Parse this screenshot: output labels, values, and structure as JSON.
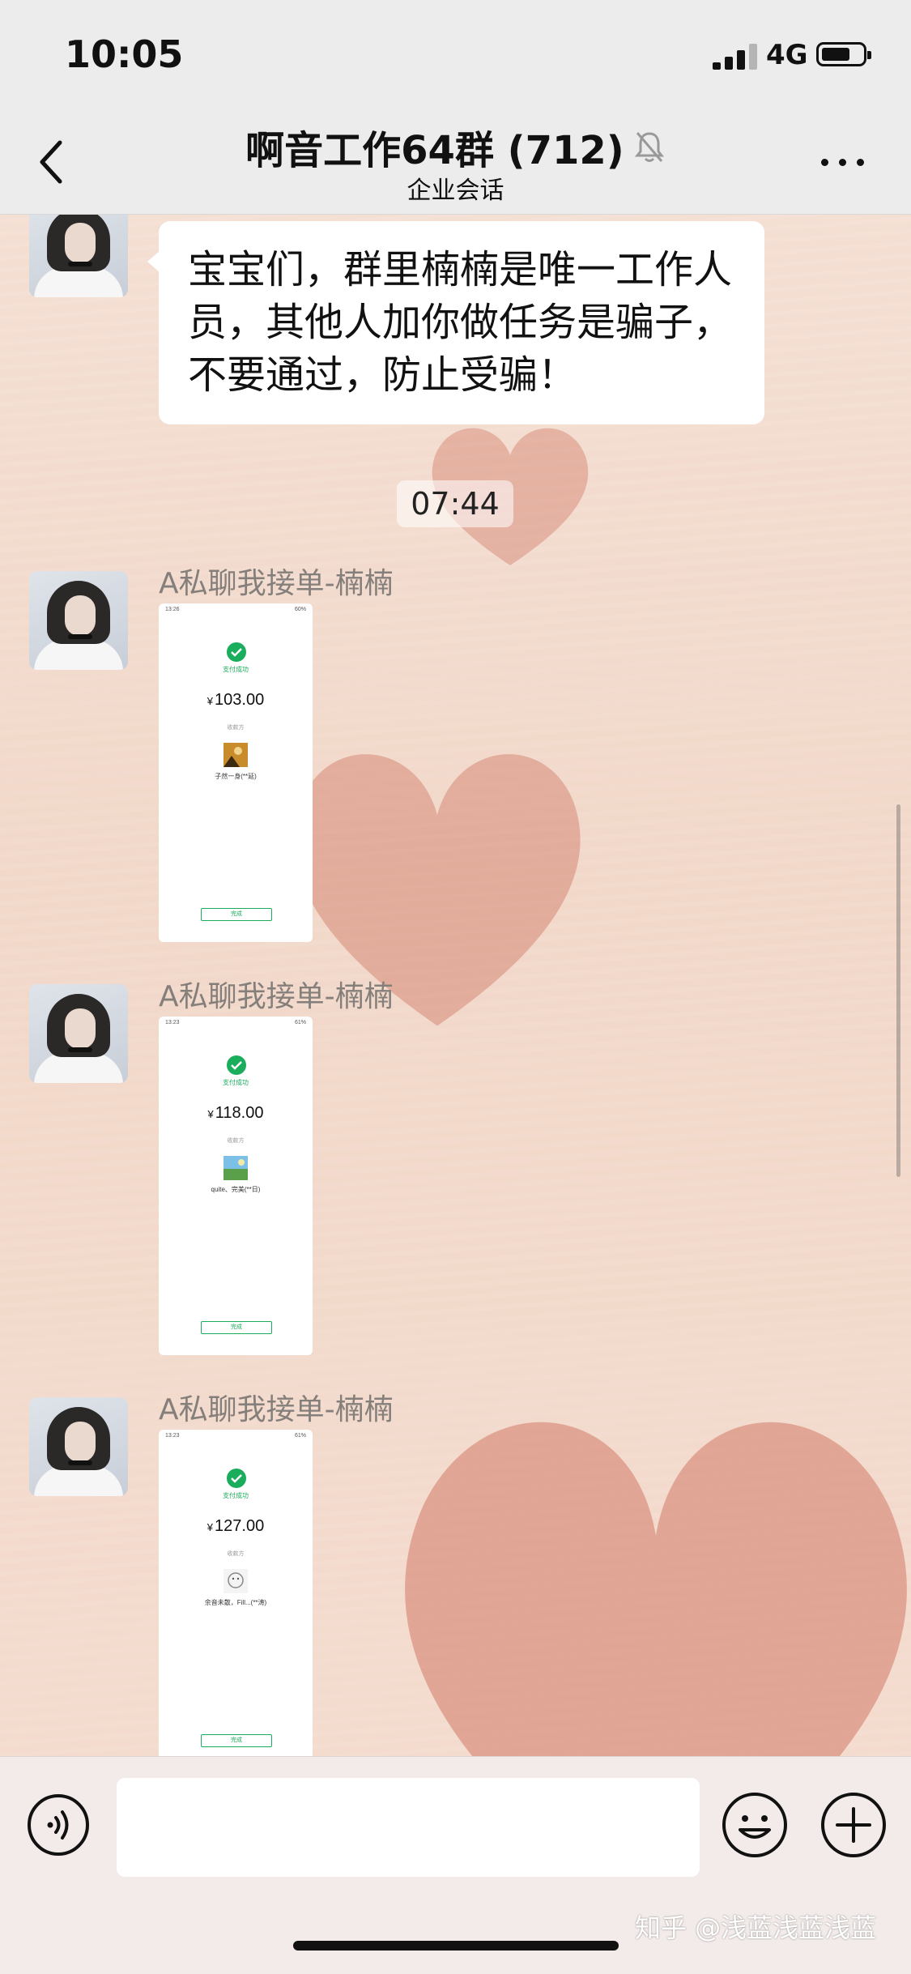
{
  "status_bar": {
    "time": "10:05",
    "network": "4G"
  },
  "nav": {
    "title": "啊音工作64群 (712)",
    "subtitle": "企业会话"
  },
  "messages": {
    "announcement_text": "宝宝们，群里楠楠是唯一工作人员，其他人加你做任务是骗子，不要通过，防止受骗！",
    "timestamp": "07:44",
    "receipts": [
      {
        "sender": "A私聊我接单-楠楠",
        "phone_time": "13:26",
        "battery": "60%",
        "paid_label": "支付成功",
        "amount": "103.00",
        "payee_label": "收款方",
        "payee": "子然一身(**延)",
        "done_label": "完成"
      },
      {
        "sender": "A私聊我接单-楠楠",
        "phone_time": "13:23",
        "battery": "61%",
        "paid_label": "支付成功",
        "amount": "118.00",
        "payee_label": "收款方",
        "payee": "quite、完美(**日)",
        "done_label": "完成"
      },
      {
        "sender": "A私聊我接单-楠楠",
        "phone_time": "13:23",
        "battery": "61%",
        "paid_label": "支付成功",
        "amount": "127.00",
        "payee_label": "收款方",
        "payee": "余音未散，Fill...(**涛)",
        "done_label": "完成"
      }
    ]
  },
  "currency_symbol": "¥",
  "watermark": "知乎 @浅蓝浅蓝浅蓝",
  "colors": {
    "wechat_green": "#1aad5b",
    "heart": "#d98f7d"
  }
}
